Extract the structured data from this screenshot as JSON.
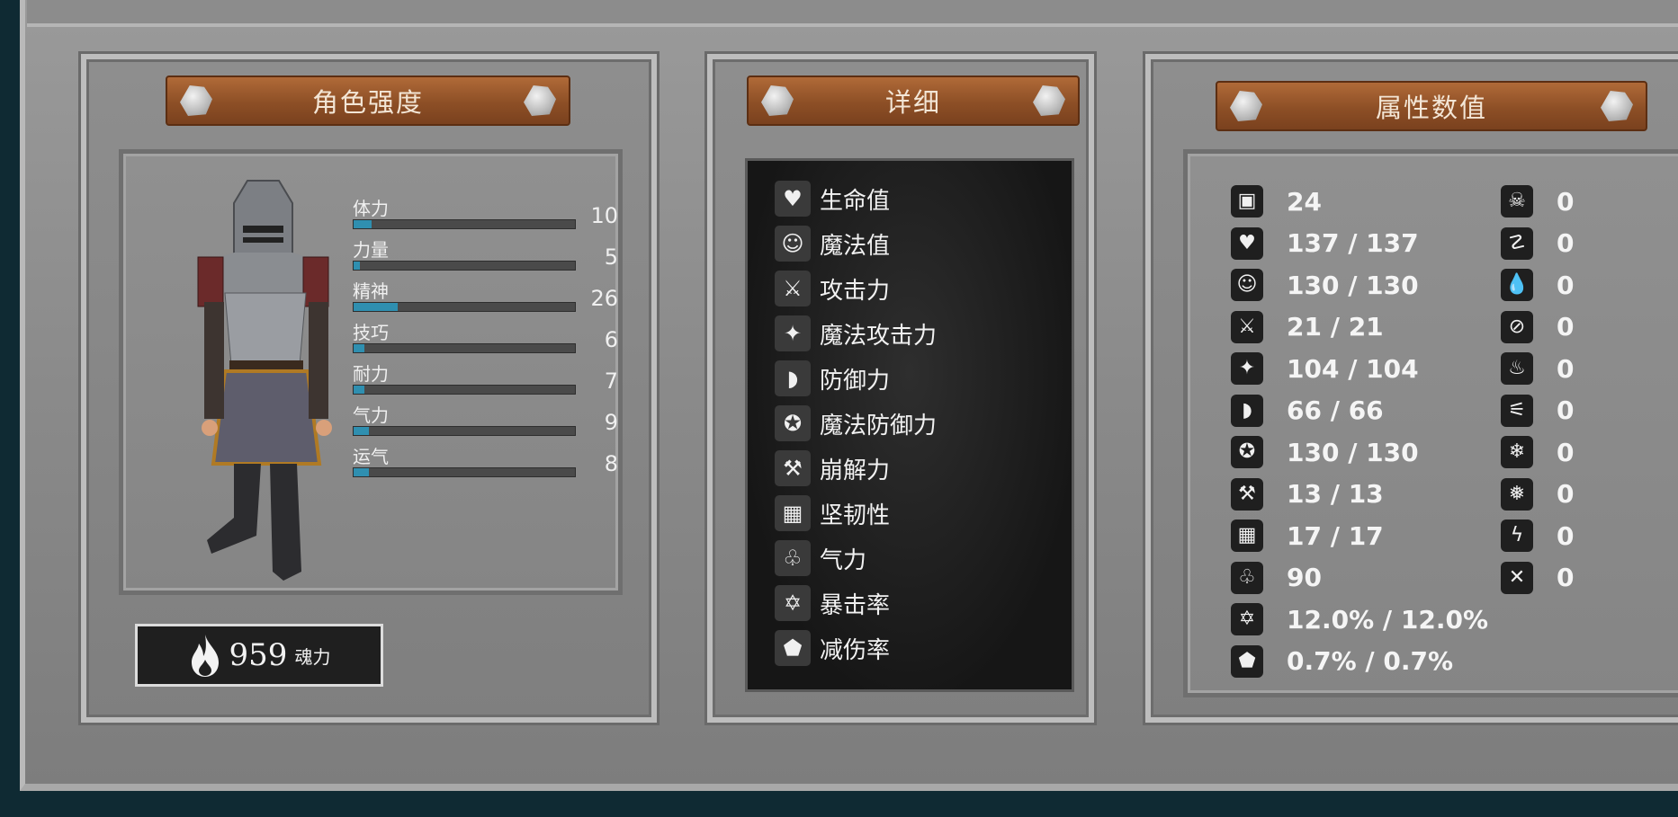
{
  "panels": {
    "strength": {
      "title": "角色强度"
    },
    "details": {
      "title": "详细"
    },
    "stats": {
      "title": "属性数值"
    }
  },
  "attributes": [
    {
      "name": "体力",
      "value": "10",
      "fill": 0.08
    },
    {
      "name": "力量",
      "value": "5",
      "fill": 0.03
    },
    {
      "name": "精神",
      "value": "26",
      "fill": 0.2
    },
    {
      "name": "技巧",
      "value": "6",
      "fill": 0.05
    },
    {
      "name": "耐力",
      "value": "7",
      "fill": 0.05
    },
    {
      "name": "气力",
      "value": "9",
      "fill": 0.07
    },
    {
      "name": "运气",
      "value": "8",
      "fill": 0.07
    }
  ],
  "soul": {
    "amount": "959",
    "label": "魂力",
    "icon": "flame-icon"
  },
  "details": [
    {
      "icon": "heart-icon",
      "label": "生命值"
    },
    {
      "icon": "head-icon",
      "label": "魔法值"
    },
    {
      "icon": "sword-icon",
      "label": "攻击力"
    },
    {
      "icon": "spellbook-icon",
      "label": "魔法攻击力"
    },
    {
      "icon": "shield-icon",
      "label": "防御力"
    },
    {
      "icon": "magic-shield-icon",
      "label": "魔法防御力"
    },
    {
      "icon": "hammer-icon",
      "label": "崩解力"
    },
    {
      "icon": "helmet-icon",
      "label": "坚韧性"
    },
    {
      "icon": "lungs-icon",
      "label": "气力"
    },
    {
      "icon": "crit-star-icon",
      "label": "暴击率"
    },
    {
      "icon": "reduction-shield-icon",
      "label": "减伤率"
    }
  ],
  "stats_left": [
    {
      "icon": "helmet-side-icon",
      "value": "24"
    },
    {
      "icon": "heart-icon",
      "value": "137 / 137"
    },
    {
      "icon": "head-icon",
      "value": "130 / 130"
    },
    {
      "icon": "sword-icon",
      "value": "21 / 21"
    },
    {
      "icon": "spellbook-icon",
      "value": "104 / 104"
    },
    {
      "icon": "shield-icon",
      "value": "66 / 66"
    },
    {
      "icon": "magic-shield-icon",
      "value": "130 / 130"
    },
    {
      "icon": "hammer-icon",
      "value": "13 / 13"
    },
    {
      "icon": "helmet-icon",
      "value": "17 / 17"
    },
    {
      "icon": "lungs-icon",
      "value": "90"
    },
    {
      "icon": "crit-star-icon",
      "value": "12.0% / 12.0%"
    },
    {
      "icon": "reduction-shield-icon",
      "value": "0.7% / 0.7%"
    }
  ],
  "stats_right": [
    {
      "icon": "skull-icon",
      "value": "0"
    },
    {
      "icon": "poison-resist-icon",
      "value": "0"
    },
    {
      "icon": "drop-icon",
      "value": "0"
    },
    {
      "icon": "bleed-resist-icon",
      "value": "0"
    },
    {
      "icon": "fire-icon",
      "value": "0"
    },
    {
      "icon": "fire-resist-icon",
      "value": "0"
    },
    {
      "icon": "frost-icon",
      "value": "0"
    },
    {
      "icon": "frost-resist-icon",
      "value": "0"
    },
    {
      "icon": "lightning-icon",
      "value": "0"
    },
    {
      "icon": "lightning-resist-icon",
      "value": "0"
    }
  ]
}
